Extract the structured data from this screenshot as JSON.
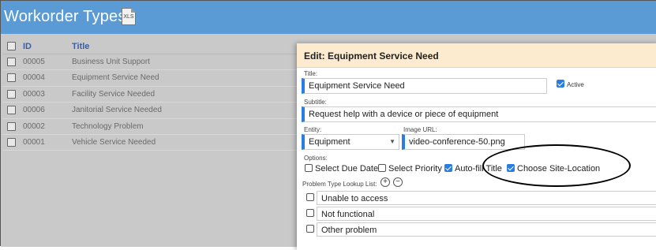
{
  "header": {
    "title": "Workorder Types",
    "xls_label": "XLS"
  },
  "table": {
    "headers": {
      "id": "ID",
      "title": "Title"
    },
    "rows": [
      {
        "id": "00005",
        "title": "Business Unit Support"
      },
      {
        "id": "00004",
        "title": "Equipment Service Need"
      },
      {
        "id": "00003",
        "title": "Facility Service Needed"
      },
      {
        "id": "00006",
        "title": "Janitorial Service Needed"
      },
      {
        "id": "00002",
        "title": "Technology Problem"
      },
      {
        "id": "00001",
        "title": "Vehicle Service Needed"
      }
    ]
  },
  "dialog": {
    "heading": "Edit: Equipment Service Need",
    "title_label": "Title:",
    "title_value": "Equipment Service Need",
    "active_label": "Active",
    "subtitle_label": "Subtitle:",
    "subtitle_value": "Request help with a device or piece of equipment",
    "entity_label": "Entity:",
    "entity_value": "Equipment",
    "image_url_label": "Image URL:",
    "image_url_value": "video-conference-50.png",
    "options_label": "Options:",
    "options": [
      {
        "label": "Select Due Date",
        "checked": false
      },
      {
        "label": "Select Priority",
        "checked": false
      },
      {
        "label": "Auto-fill Title",
        "checked": true
      },
      {
        "label": "Choose Site-Location",
        "checked": true
      }
    ],
    "lookup_label": "Problem Type Lookup List:",
    "lookup_items": [
      "Unable to access",
      "Not functional",
      "Other problem"
    ]
  },
  "colors": {
    "header_bg": "#5b9bd5",
    "dialog_head_bg": "#fdebd0",
    "accent": "#2a7de1"
  }
}
